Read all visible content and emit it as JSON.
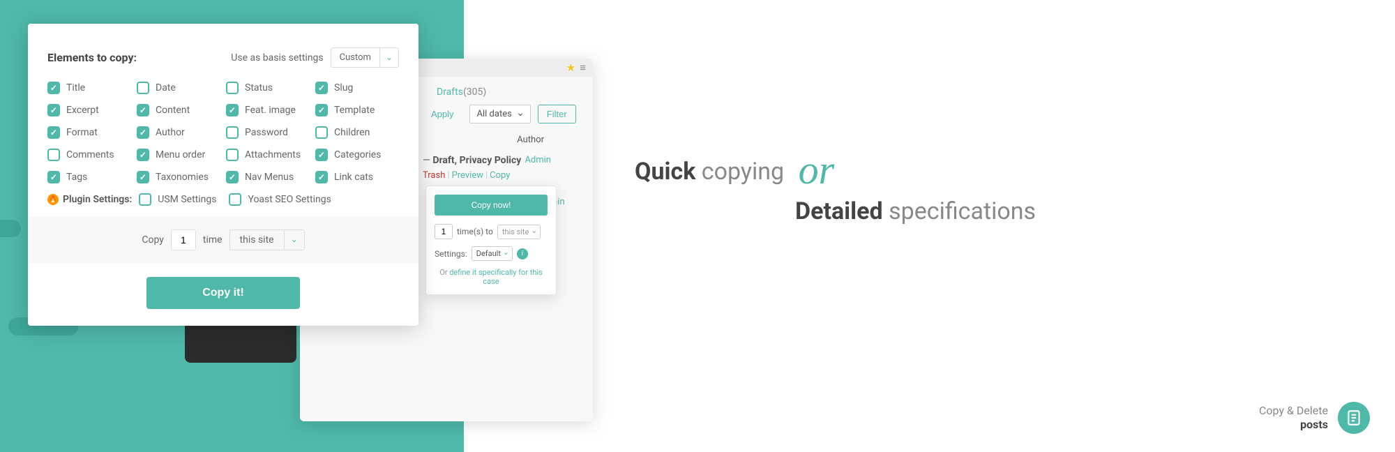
{
  "panel": {
    "heading": "Elements to copy:",
    "basis_label": "Use as basis settings",
    "basis_value": "Custom",
    "checkboxes": [
      {
        "label": "Title",
        "checked": true
      },
      {
        "label": "Date",
        "checked": false
      },
      {
        "label": "Status",
        "checked": false
      },
      {
        "label": "Slug",
        "checked": true
      },
      {
        "label": "Excerpt",
        "checked": true
      },
      {
        "label": "Content",
        "checked": true
      },
      {
        "label": "Feat. image",
        "checked": true
      },
      {
        "label": "Template",
        "checked": true
      },
      {
        "label": "Format",
        "checked": true
      },
      {
        "label": "Author",
        "checked": true
      },
      {
        "label": "Password",
        "checked": false
      },
      {
        "label": "Children",
        "checked": false
      },
      {
        "label": "Comments",
        "checked": false
      },
      {
        "label": "Menu order",
        "checked": true
      },
      {
        "label": "Attachments",
        "checked": false
      },
      {
        "label": "Categories",
        "checked": true
      },
      {
        "label": "Tags",
        "checked": true
      },
      {
        "label": "Taxonomies",
        "checked": true
      },
      {
        "label": "Nav Menus",
        "checked": true
      },
      {
        "label": "Link cats",
        "checked": true
      }
    ],
    "plugin_label": "Plugin Settings:",
    "plugin_checks": [
      {
        "label": "USM Settings",
        "checked": false
      },
      {
        "label": "Yoast SEO Settings",
        "checked": false
      }
    ],
    "copy_word": "Copy",
    "copy_count": "1",
    "time_word": "time",
    "site_value": "this site",
    "main_button": "Copy it!"
  },
  "browser": {
    "drafts_label": "Drafts",
    "drafts_count": "(305)",
    "apply": "Apply",
    "dates": "All dates",
    "filter": "Filter",
    "author_hdr": "Author",
    "post_prefix": "—",
    "post_strong": "Draft, Privacy Policy",
    "admin": "Admin",
    "trash": "Trash",
    "preview": "Preview",
    "copy": "Copy",
    "admin_peek": "nin"
  },
  "popover": {
    "copy_now": "Copy now!",
    "times_value": "1",
    "times_label": "time(s) to",
    "site_value": "this site",
    "settings_label": "Settings:",
    "settings_value": "Default",
    "or_word": "Or",
    "or_link": "define it specifically for this case"
  },
  "marketing": {
    "quick_bold": "Quick",
    "quick_rest": "copying",
    "or": "or",
    "detailed_bold": "Detailed",
    "detailed_rest": "specifications"
  },
  "brand": {
    "line1": "Copy & Delete",
    "line2": "posts"
  }
}
